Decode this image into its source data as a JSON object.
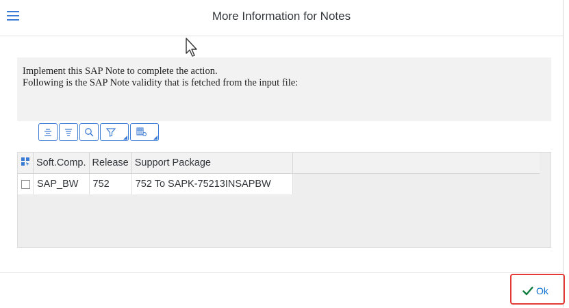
{
  "dialog": {
    "title": "More Information  for Notes",
    "message_line1": "Implement this SAP Note to complete the action.",
    "message_line2": "Following is the SAP Note validity that is fetched from the input file:"
  },
  "toolbar": {
    "buttons": [
      "align-center-icon",
      "align-justify-icon",
      "search-icon",
      "filter-icon",
      "settings-table-icon"
    ]
  },
  "table": {
    "columns": [
      "Soft.Comp.",
      "Release",
      "Support Package"
    ],
    "rows": [
      {
        "soft_comp": "SAP_BW",
        "release": "752",
        "support_package": "752 To SAPK-75213INSAPBW"
      }
    ]
  },
  "footer": {
    "ok_label": "Ok"
  },
  "colors": {
    "accent": "#0a6ed1",
    "ok_check": "#107e3e",
    "highlight": "#e53935"
  }
}
